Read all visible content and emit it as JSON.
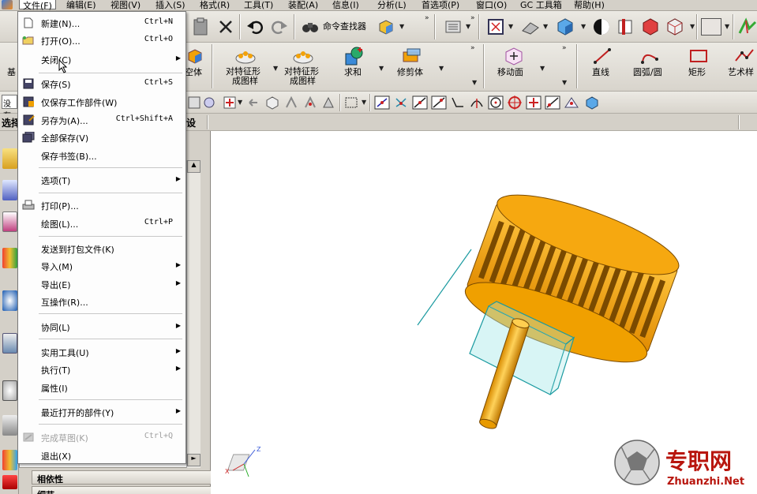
{
  "menubar": {
    "items": [
      {
        "label": "文件(F)",
        "active": true
      },
      {
        "label": "编辑(E)"
      },
      {
        "label": "视图(V)"
      },
      {
        "label": "插入(S)"
      },
      {
        "label": "格式(R)"
      },
      {
        "label": "工具(T)"
      },
      {
        "label": "装配(A)"
      },
      {
        "label": "信息(I)"
      },
      {
        "label": "分析(L)"
      },
      {
        "label": "首选项(P)"
      },
      {
        "label": "窗口(O)"
      },
      {
        "label": "GC 工具箱"
      },
      {
        "label": "帮助(H)"
      }
    ]
  },
  "toolbar_top": {
    "command_finder_label": "命令查找器"
  },
  "toolbar_features": {
    "left_cut_label": "基",
    "block_label": "空体",
    "pattern_feature_label_1": "对特征形",
    "pattern_feature_label_2": "成图样",
    "pattern_feature2_label_1": "对特征形",
    "pattern_feature2_label_2": "成图样",
    "unite_label": "求和",
    "trim_body_label": "修剪体",
    "move_face_label": "移动面",
    "line_label": "直线",
    "arc_label": "圆弧/圆",
    "rect_label": "矩形",
    "studio_spline_label": "艺术样"
  },
  "selection_bar": {
    "filter_value": "没有",
    "left_label": "选择",
    "right_label": "设"
  },
  "file_menu": {
    "items": [
      {
        "label": "新建(N)...",
        "shortcut": "Ctrl+N",
        "icon": "new-file-icon"
      },
      {
        "label": "打开(O)...",
        "shortcut": "Ctrl+O",
        "icon": "open-folder-icon"
      },
      {
        "label": "关闭(C)",
        "submenu": true
      },
      {
        "label": "保存(S)",
        "shortcut": "Ctrl+S",
        "icon": "save-icon"
      },
      {
        "label": "仅保存工作部件(W)",
        "icon": "save-work-part-icon"
      },
      {
        "label": "另存为(A)...",
        "shortcut": "Ctrl+Shift+A",
        "icon": "save-as-icon"
      },
      {
        "label": "全部保存(V)",
        "icon": "save-all-icon"
      },
      {
        "label": "保存书签(B)..."
      },
      {
        "label": "选项(T)",
        "submenu": true
      },
      {
        "label": "打印(P)...",
        "icon": "print-icon"
      },
      {
        "label": "绘图(L)...",
        "shortcut": "Ctrl+P"
      },
      {
        "label": "发送到打包文件(K)"
      },
      {
        "label": "导入(M)",
        "submenu": true
      },
      {
        "label": "导出(E)",
        "submenu": true
      },
      {
        "label": "互操作(R)..."
      },
      {
        "label": "协同(L)",
        "submenu": true
      },
      {
        "label": "实用工具(U)",
        "submenu": true
      },
      {
        "label": "执行(T)",
        "submenu": true
      },
      {
        "label": "属性(I)"
      },
      {
        "label": "最近打开的部件(Y)",
        "submenu": true
      },
      {
        "label": "完成草图(K)",
        "shortcut": "Ctrl+Q",
        "disabled": true,
        "icon": "finish-sketch-icon"
      },
      {
        "label": "退出(X)"
      }
    ]
  },
  "navigator": {
    "dependencies_label": "相依性",
    "details_label": "细节"
  },
  "watermark": {
    "cn_text": "专职网",
    "en_text": "Zhuanzhi.Net"
  },
  "colors": {
    "model_orange": "#f2a20a",
    "model_dark": "#7a4a00",
    "sketch_cyan": "#1a9aa0",
    "menu_bg": "#fdfdfd",
    "watermark_red": "#b8160e"
  },
  "triad": {
    "z_label": "Z",
    "x_label": "X",
    "y_label": "Y"
  }
}
